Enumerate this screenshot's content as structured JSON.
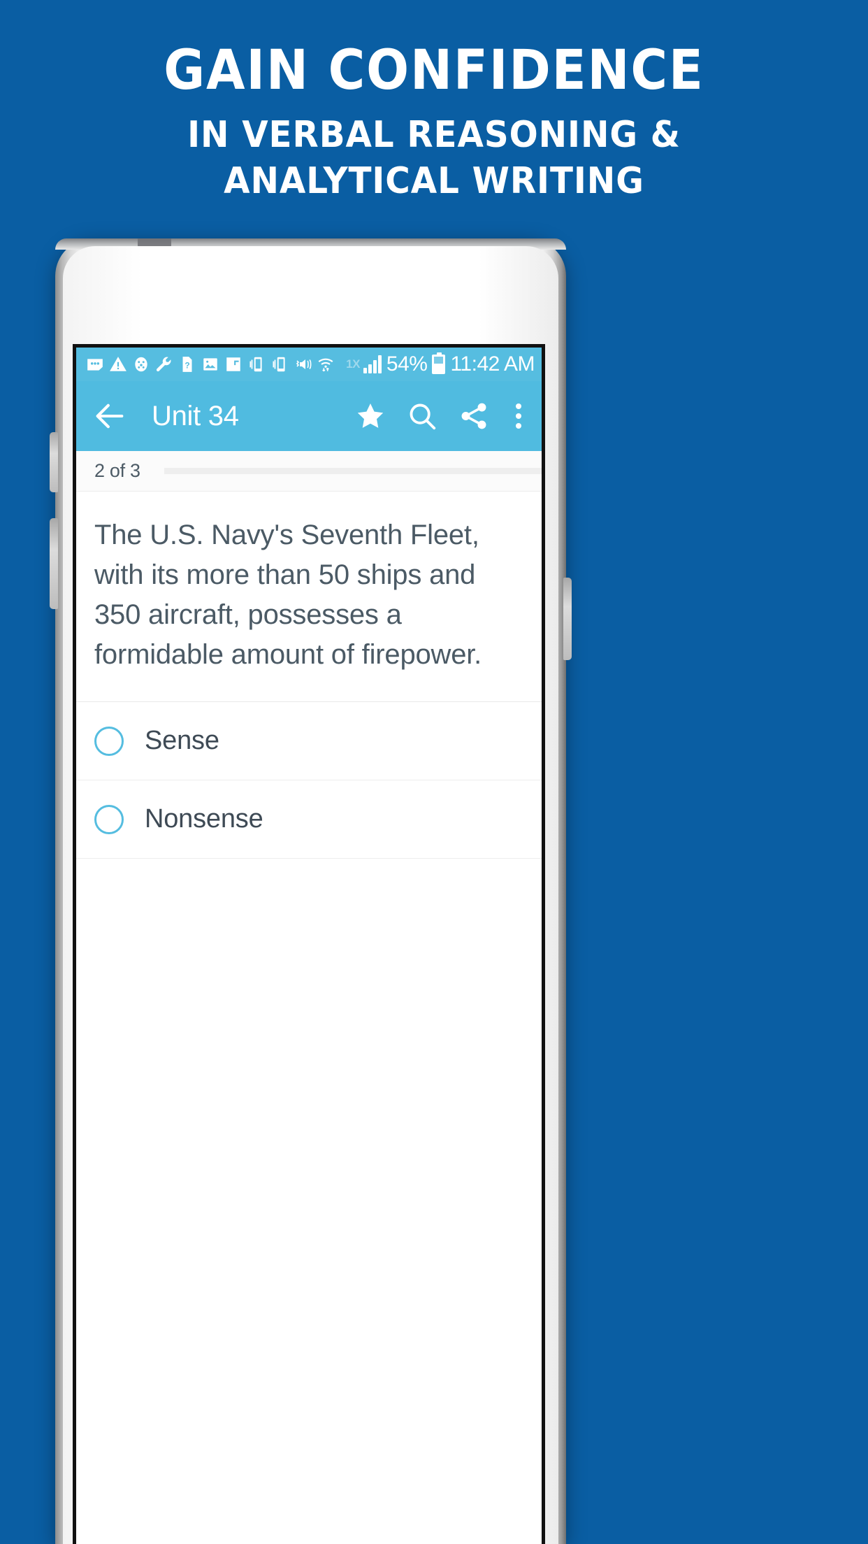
{
  "promo": {
    "headline": "GAIN CONFIDENCE",
    "subtitle_line1": "IN VERBAL REASONING &",
    "subtitle_line2": "ANALYTICAL WRITING",
    "background_color": "#0a5ea3",
    "text_color": "#ffffff"
  },
  "device": {
    "body_color": "#ffffff",
    "frame_color": "#b9b9b9",
    "icons": {
      "proximity_sensor": "sensor-dot-icon",
      "front_camera": "camera-lens-icon",
      "earpiece_speaker": "speaker-grille-icon"
    }
  },
  "app": {
    "accent_color": "#50bbe0",
    "statusbar": {
      "background_color": "#56bde0",
      "notification_icons": [
        "message-bubble-icon",
        "warning-triangle-icon",
        "bug-icon",
        "wrench-icon",
        "unknown-sim-icon",
        "image-icon",
        "flipboard-icon",
        "vibrate-phone-icon",
        "vibrate-phone-icon-2",
        "mute-volume-icon",
        "wifi-transfer-icon"
      ],
      "network_type": "1X",
      "signal_icon": "signal-bars-icon",
      "battery_percent": "54%",
      "battery_icon": "battery-icon",
      "time": "11:42 AM"
    },
    "appbar": {
      "background_color": "#50bbe0",
      "back_icon": "arrow-back-icon",
      "title": "Unit 34",
      "actions": [
        {
          "icon": "star-icon",
          "name": "favorite-button"
        },
        {
          "icon": "search-icon",
          "name": "search-button"
        },
        {
          "icon": "share-icon",
          "name": "share-button"
        },
        {
          "icon": "overflow-menu-icon",
          "name": "overflow-menu-button"
        }
      ]
    },
    "progress": {
      "label": "2 of 3",
      "current": 2,
      "total": 3,
      "fill_percent": 0,
      "track_color": "#eeeeee"
    },
    "question": {
      "text": "The U.S. Navy's Seventh Fleet, with its more than 50 ships and 350 aircraft, possesses a formidable amount of firepower.",
      "text_color": "#4b5a65"
    },
    "options": [
      {
        "label": "Sense",
        "selected": false
      },
      {
        "label": "Nonsense",
        "selected": false
      }
    ]
  }
}
